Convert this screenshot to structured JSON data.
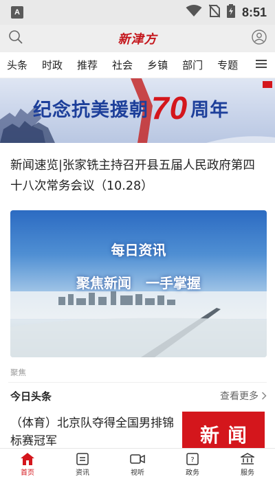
{
  "status_bar": {
    "time": "8:51",
    "badge": "A"
  },
  "header": {
    "logo": "新津方"
  },
  "nav": {
    "tabs": [
      "头条",
      "时政",
      "推荐",
      "社会",
      "乡镇",
      "部门",
      "专题"
    ]
  },
  "banner": {
    "text_before": "纪念抗美援朝",
    "number": "70",
    "text_after": "周年"
  },
  "article": {
    "title": "新闻速览|张家铣主持召开县五届人民政府第四十八次常务会议（10.28）",
    "image_line1": "每日资讯",
    "image_line2": "聚焦新闻 一手掌握",
    "tag": "聚焦"
  },
  "section": {
    "title": "今日头条",
    "more": "查看更多"
  },
  "news_items": [
    {
      "text": "（体育）北京队夺得全国男排锦标赛冠军",
      "thumb": "新闻"
    }
  ],
  "bottom_nav": [
    {
      "label": "首页",
      "icon": "home-icon",
      "active": true
    },
    {
      "label": "资讯",
      "icon": "news-icon",
      "active": false
    },
    {
      "label": "视听",
      "icon": "video-icon",
      "active": false
    },
    {
      "label": "政务",
      "icon": "government-icon",
      "active": false
    },
    {
      "label": "服务",
      "icon": "service-icon",
      "active": false
    }
  ],
  "colors": {
    "accent": "#d4161c",
    "banner_blue": "#1d3f9a"
  }
}
